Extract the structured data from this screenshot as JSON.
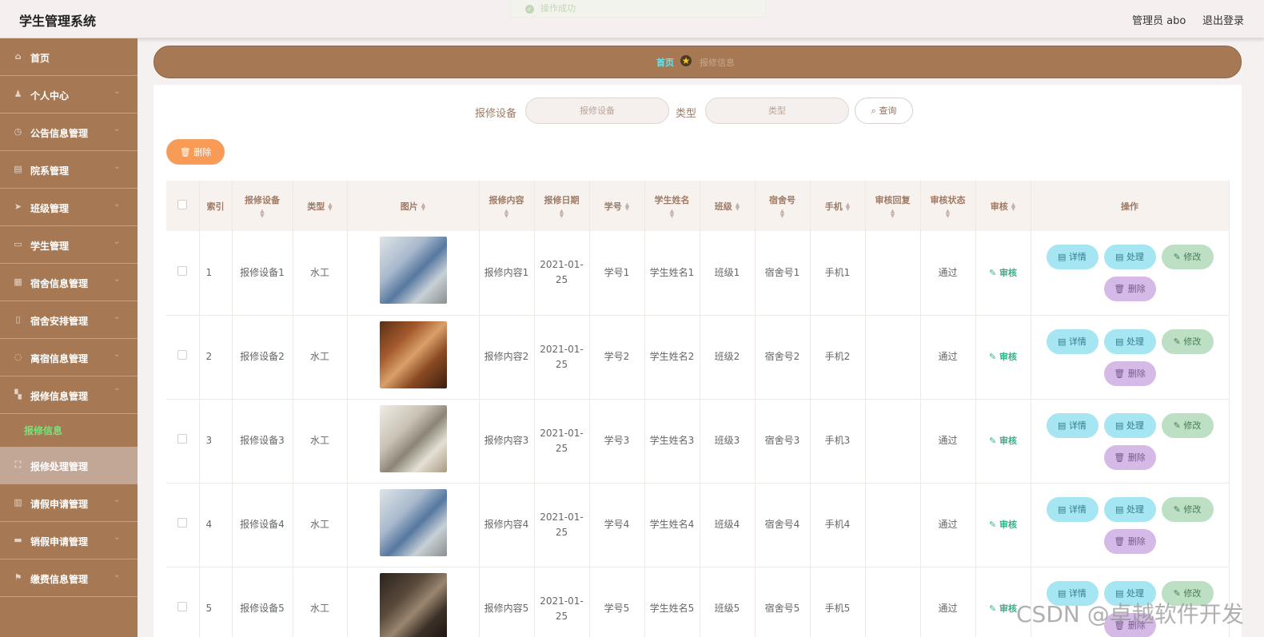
{
  "app": {
    "title": "学生管理系统",
    "admin_label": "管理员 abo",
    "logout_label": "退出登录",
    "toast": "操作成功"
  },
  "sidebar": {
    "items": [
      {
        "label": "首页",
        "icon": "home-icon",
        "glyph": "⌂",
        "chevron": false
      },
      {
        "label": "个人中心",
        "icon": "user-icon",
        "glyph": "♟",
        "chevron": true
      },
      {
        "label": "公告信息管理",
        "icon": "clock-icon",
        "glyph": "◷",
        "chevron": true
      },
      {
        "label": "院系管理",
        "icon": "clipboard-icon",
        "glyph": "▤",
        "chevron": true
      },
      {
        "label": "班级管理",
        "icon": "send-icon",
        "glyph": "➤",
        "chevron": true
      },
      {
        "label": "学生管理",
        "icon": "message-icon",
        "glyph": "▭",
        "chevron": true
      },
      {
        "label": "宿舍信息管理",
        "icon": "grid-icon",
        "glyph": "▦",
        "chevron": true
      },
      {
        "label": "宿舍安排管理",
        "icon": "microphone-icon",
        "glyph": "▯",
        "chevron": true
      },
      {
        "label": "离宿信息管理",
        "icon": "power-icon",
        "glyph": "◌",
        "chevron": true
      },
      {
        "label": "报修信息管理",
        "icon": "apps-icon",
        "glyph": "▚",
        "chevron": true,
        "expanded": true
      },
      {
        "label": "报修信息",
        "submenu": true
      },
      {
        "label": "报修处理管理",
        "icon": "fullscreen-icon",
        "glyph": "⛶",
        "chevron": true,
        "hover": true
      },
      {
        "label": "请假申请管理",
        "icon": "bank-icon",
        "glyph": "▥",
        "chevron": true
      },
      {
        "label": "销假申请管理",
        "icon": "monitor-icon",
        "glyph": "▬",
        "chevron": true
      },
      {
        "label": "缴费信息管理",
        "icon": "flag-icon",
        "glyph": "⚑",
        "chevron": true
      }
    ]
  },
  "breadcrumb": {
    "home": "首页",
    "current": "报修信息"
  },
  "search": {
    "device_label": "报修设备",
    "device_placeholder": "报修设备",
    "type_label": "类型",
    "type_placeholder": "类型",
    "query_label": "查询"
  },
  "toolbar": {
    "delete_label": "删除"
  },
  "table": {
    "headers": [
      "索引",
      "报修设备",
      "类型",
      "图片",
      "报修内容",
      "报修日期",
      "学号",
      "学生姓名",
      "班级",
      "宿舍号",
      "手机",
      "审核回复",
      "审核状态",
      "审核",
      "操作"
    ],
    "rows": [
      {
        "index": "1",
        "device": "报修设备1",
        "type": "水工",
        "content": "报修内容1",
        "date": "2021-01-25",
        "sid": "学号1",
        "name": "学生姓名1",
        "class": "班级1",
        "dorm": "宿舍号1",
        "phone": "手机1",
        "reply": "",
        "status": "通过",
        "image_color": "dorm-blue"
      },
      {
        "index": "2",
        "device": "报修设备2",
        "type": "水工",
        "content": "报修内容2",
        "date": "2021-01-25",
        "sid": "学号2",
        "name": "学生姓名2",
        "class": "班级2",
        "dorm": "宿舍号2",
        "phone": "手机2",
        "reply": "",
        "status": "通过",
        "image_color": "dorm-wood"
      },
      {
        "index": "3",
        "device": "报修设备3",
        "type": "水工",
        "content": "报修内容3",
        "date": "2021-01-25",
        "sid": "学号3",
        "name": "学生姓名3",
        "class": "班级3",
        "dorm": "宿舍号3",
        "phone": "手机3",
        "reply": "",
        "status": "通过",
        "image_color": "dorm-light"
      },
      {
        "index": "4",
        "device": "报修设备4",
        "type": "水工",
        "content": "报修内容4",
        "date": "2021-01-25",
        "sid": "学号4",
        "name": "学生姓名4",
        "class": "班级4",
        "dorm": "宿舍号4",
        "phone": "手机4",
        "reply": "",
        "status": "通过",
        "image_color": "dorm-blue"
      },
      {
        "index": "5",
        "device": "报修设备5",
        "type": "水工",
        "content": "报修内容5",
        "date": "2021-01-25",
        "sid": "学号5",
        "name": "学生姓名5",
        "class": "班级5",
        "dorm": "宿舍号5",
        "phone": "手机5",
        "reply": "",
        "status": "通过",
        "image_color": "dorm-dark"
      }
    ],
    "audit_label": "审核",
    "actions": {
      "detail": "详情",
      "handle": "处理",
      "edit": "修改",
      "delete": "删除"
    }
  },
  "watermark": "CSDN @卓越软件开发",
  "colors": {
    "sidebar": "#a67954",
    "accent_orange": "#f79b56",
    "button_cyan": "#a6e6f3",
    "button_green": "#bde0c4",
    "button_purple": "#d5b9e6"
  }
}
